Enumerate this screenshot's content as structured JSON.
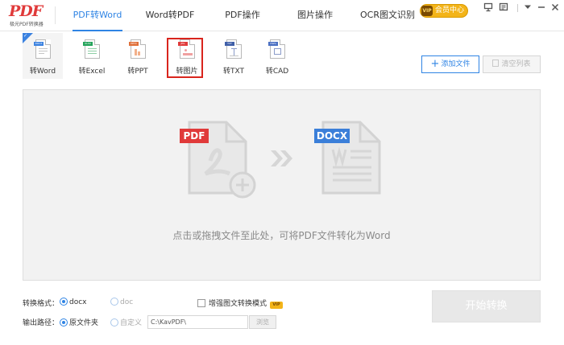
{
  "app": {
    "logo_text": "PDF",
    "logo_subtitle": "极光PDF转换器"
  },
  "nav": {
    "tabs": [
      {
        "label": "PDF转Word",
        "active": true
      },
      {
        "label": "Word转PDF",
        "active": false
      },
      {
        "label": "PDF操作",
        "active": false
      },
      {
        "label": "图片操作",
        "active": false
      },
      {
        "label": "OCR图文识别",
        "active": false
      }
    ]
  },
  "vip": {
    "badge": "VIP",
    "label": "会员中心"
  },
  "window_buttons": [
    "screen-icon",
    "message-icon",
    "dropdown-icon",
    "minimize-icon",
    "close-icon"
  ],
  "tools": [
    {
      "label": "转Word",
      "tag": "DOCX",
      "tag_color": "#3b82e0",
      "selected": true
    },
    {
      "label": "转Excel",
      "tag": "XLSX",
      "tag_color": "#23a35a",
      "selected": false
    },
    {
      "label": "转PPT",
      "tag": "PPTX",
      "tag_color": "#e0703a",
      "selected": false
    },
    {
      "label": "转图片",
      "tag": "JPG",
      "tag_color": "#e03a3a",
      "selected": false
    },
    {
      "label": "转TXT",
      "tag": "TXT",
      "tag_color": "#3f5fa8",
      "selected": false
    },
    {
      "label": "转CAD",
      "tag": "DWG",
      "tag_color": "#4a6fc2",
      "selected": false
    }
  ],
  "actions": {
    "add_file": "添加文件",
    "clear_list": "清空列表"
  },
  "drop": {
    "from_tag": "PDF",
    "to_tag": "DOCX",
    "hint": "点击或拖拽文件至此处，可将PDF文件转化为Word"
  },
  "options": {
    "format_label": "转换格式：",
    "format_docx": "docx",
    "format_doc": "doc",
    "enhance_label": "增强图文转换模式",
    "output_label": "输出路径：",
    "output_source": "原文件夹",
    "output_custom": "自定义",
    "path_value": "C:\\KavPDF\\",
    "browse": "浏览"
  },
  "start_button": "开始转换",
  "colors": {
    "accent": "#2f84e4",
    "highlight": "#d9251d",
    "vip": "#f3b419"
  }
}
